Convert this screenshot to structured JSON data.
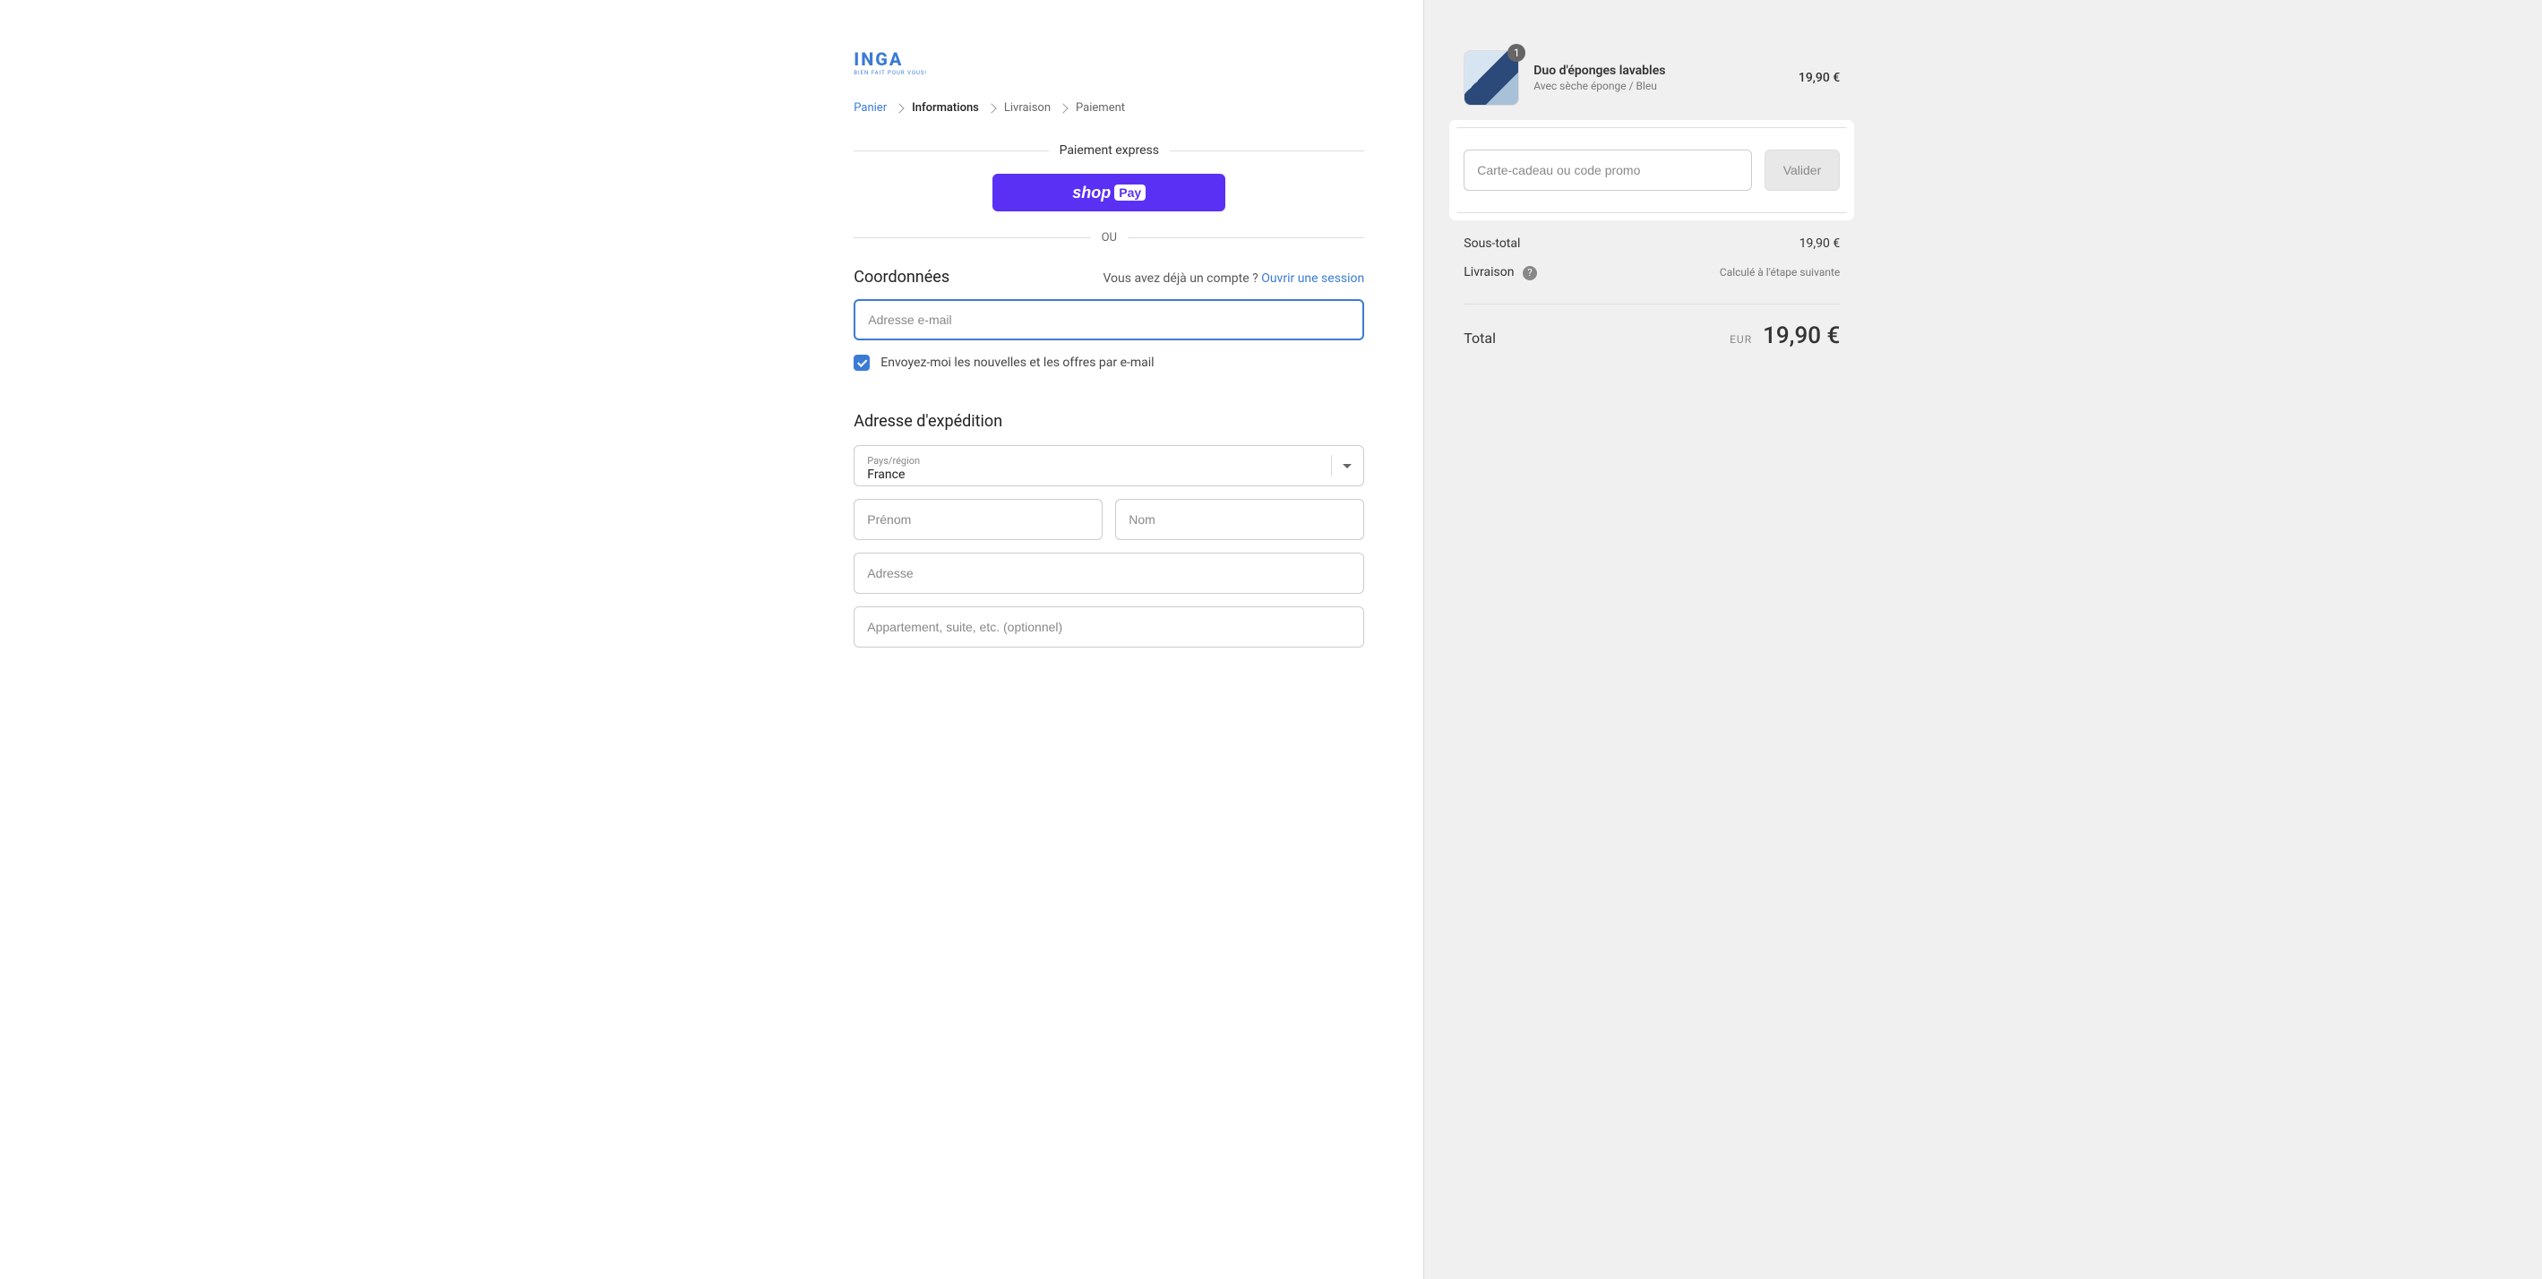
{
  "logo": {
    "text": "INGA",
    "subtext": "BIEN FAIT POUR VOUS!"
  },
  "breadcrumb": {
    "cart": "Panier",
    "information": "Informations",
    "shipping": "Livraison",
    "payment": "Paiement"
  },
  "express": {
    "title": "Paiement express",
    "shoppay_shop": "shop",
    "shoppay_pay": "Pay",
    "or": "OU"
  },
  "contact": {
    "title": "Coordonnées",
    "have_account": "Vous avez déjà un compte ? ",
    "login_link": "Ouvrir une session",
    "email_placeholder": "Adresse e-mail",
    "newsletter": "Envoyez-moi les nouvelles et les offres par e-mail"
  },
  "shipping": {
    "title": "Adresse d'expédition",
    "country_label": "Pays/région",
    "country_value": "France",
    "firstname_placeholder": "Prénom",
    "lastname_placeholder": "Nom",
    "address_placeholder": "Adresse",
    "address2_placeholder": "Appartement, suite, etc. (optionnel)"
  },
  "cart": {
    "item": {
      "quantity": "1",
      "title": "Duo d'éponges lavables",
      "variant": "Avec sèche éponge / Bleu",
      "price": "19,90 €"
    },
    "promo_placeholder": "Carte-cadeau ou code promo",
    "promo_button": "Valider",
    "subtotal_label": "Sous-total",
    "subtotal_value": "19,90 €",
    "shipping_label": "Livraison",
    "shipping_note": "Calculé à l'étape suivante",
    "total_label": "Total",
    "total_currency": "EUR",
    "total_value": "19,90 €"
  }
}
